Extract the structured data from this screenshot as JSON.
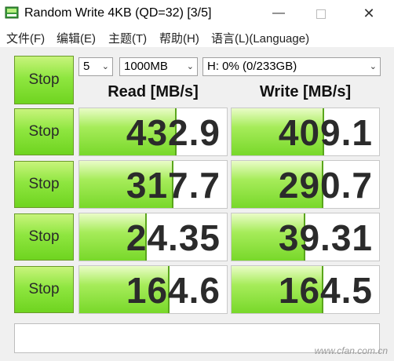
{
  "window": {
    "title": "Random Write 4KB (QD=32) [3/5]",
    "minimize_glyph": "—",
    "close_glyph": "✕"
  },
  "menu": [
    "文件(F)",
    "编辑(E)",
    "主题(T)",
    "帮助(H)",
    "语言(L)(Language)"
  ],
  "controls": {
    "runs": "5",
    "size": "1000MB",
    "drive": "H: 0% (0/233GB)"
  },
  "headers": {
    "read": "Read [MB/s]",
    "write": "Write [MB/s]"
  },
  "buttons": {
    "stop": "Stop"
  },
  "rows": [
    {
      "read": "432.9",
      "write": "409.1",
      "read_fill_pct": 66,
      "write_fill_pct": 63
    },
    {
      "read": "317.7",
      "write": "290.7",
      "read_fill_pct": 64,
      "write_fill_pct": 62
    },
    {
      "read": "24.35",
      "write": "39.31",
      "read_fill_pct": 46,
      "write_fill_pct": 50
    },
    {
      "read": "164.6",
      "write": "164.5",
      "read_fill_pct": 61,
      "write_fill_pct": 62
    }
  ],
  "watermark": "www.cfan.com.cn",
  "colors": {
    "accent_green": "#78d82a",
    "button_green": "#8fe640"
  }
}
